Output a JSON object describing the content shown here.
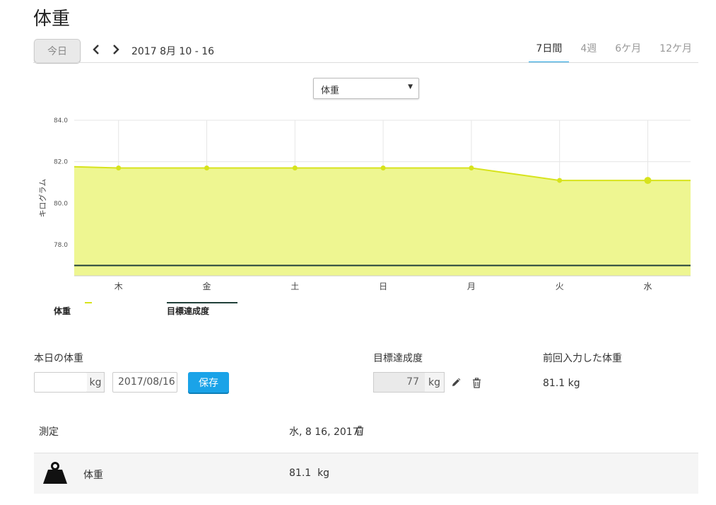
{
  "page": {
    "title": "体重"
  },
  "toolbar": {
    "today_label": "今日",
    "date_range": "2017 8月 10 - 16",
    "range_tabs": [
      "7日間",
      "4週",
      "6ケ月",
      "12ケ月"
    ],
    "active_tab": "7日間"
  },
  "metric_select": {
    "value": "体重"
  },
  "chart_data": {
    "type": "area",
    "categories": [
      "木",
      "金",
      "土",
      "日",
      "月",
      "火",
      "水"
    ],
    "series": [
      {
        "name": "体重",
        "values": [
          81.7,
          81.7,
          81.7,
          81.7,
          81.7,
          81.1,
          81.1
        ],
        "color": "#d7e31c"
      },
      {
        "name": "目標達成度",
        "values": [
          77,
          77,
          77,
          77,
          77,
          77,
          77
        ],
        "color": "#21403a"
      }
    ],
    "ylabel": "キログラム",
    "ylim": [
      76.5,
      84.0
    ],
    "yticks": [
      "84.0",
      "82.0",
      "80.0",
      "78.0"
    ],
    "grid": true,
    "legend": "bottom-left"
  },
  "entry": {
    "label": "本日の体重",
    "weight_value": "",
    "unit": "kg",
    "date_value": "2017/08/16",
    "save_label": "保存"
  },
  "goal": {
    "label": "目標達成度",
    "value": "77",
    "unit": "kg"
  },
  "last": {
    "label": "前回入力した体重",
    "value": "81.1 kg"
  },
  "log": {
    "header_label": "測定",
    "header_date": "水, 8 16, 2017",
    "rows": [
      {
        "label": "体重",
        "value": "81.1  kg"
      }
    ]
  },
  "icons": {
    "prev": "chevron-left-icon",
    "next": "chevron-right-icon",
    "edit": "pencil-icon",
    "delete": "trash-icon",
    "weight": "weight-icon",
    "accent": "#1ba1e2"
  }
}
